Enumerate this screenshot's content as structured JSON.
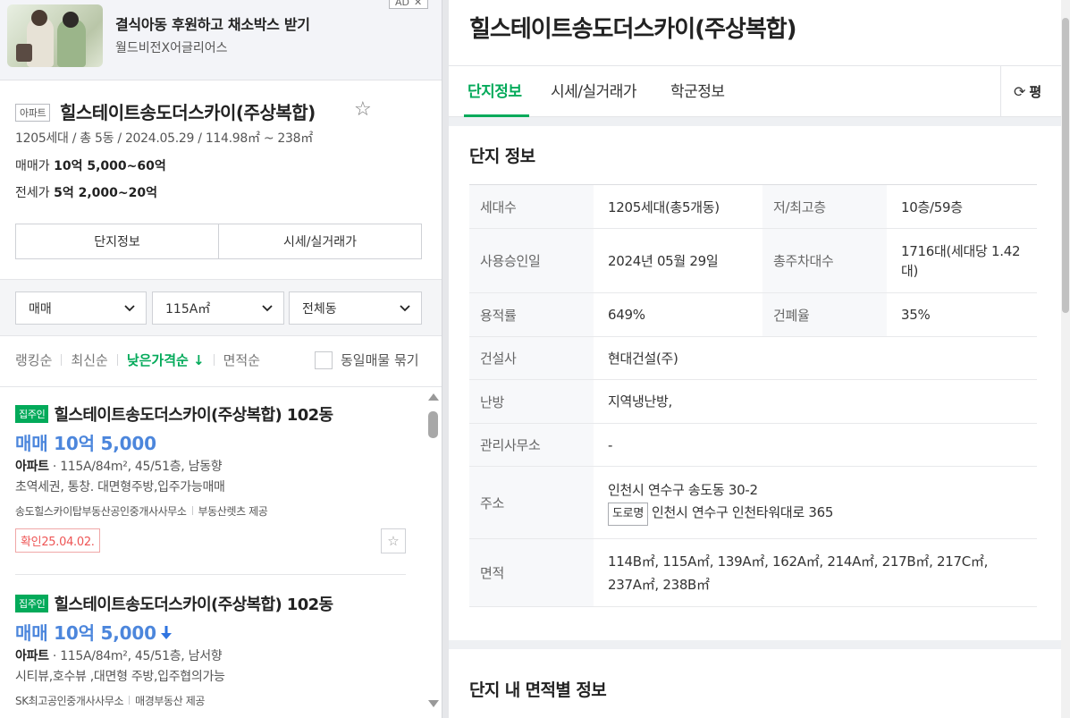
{
  "ad": {
    "title": "결식아동 후원하고 채소박스 받기",
    "subtitle": "월드비전X어글리어스",
    "badge": "AD",
    "close": "✕"
  },
  "summary": {
    "type_badge": "아파트",
    "name": "힐스테이트송도더스카이(주상복합)",
    "meta": "1205세대 / 총 5동 / 2024.05.29 / 114.98㎡ ~ 238㎡",
    "sale_label": "매매가",
    "sale_value": "10억 5,000~60억",
    "jeonse_label": "전세가",
    "jeonse_value": "5억 2,000~20억",
    "buttons": [
      "단지정보",
      "시세/실거래가"
    ]
  },
  "filters": {
    "trade": "매매",
    "area": "115A㎡",
    "dong": "전체동"
  },
  "sort": {
    "options": [
      "랭킹순",
      "최신순",
      "낮은가격순 ↓",
      "면적순"
    ],
    "active_index": 2,
    "same_listing_label": "동일매물 묶기"
  },
  "listings": [
    {
      "tag": "집주인",
      "title": "힐스테이트송도더스카이(주상복합) 102동",
      "price": "매매 10억 5,000",
      "price_down": false,
      "type": "아파트",
      "spec": "115A/84m², 45/51층, 남동향",
      "desc": "초역세권, 통창. 대면형주방,입주가능매매",
      "agent": "송도힐스카이탑부동산공인중개사사무소",
      "provider": "부동산렛츠 제공",
      "confirm": "확인25.04.02."
    },
    {
      "tag": "집주인",
      "title": "힐스테이트송도더스카이(주상복합) 102동",
      "price": "매매 10억 5,000",
      "price_down": true,
      "type": "아파트",
      "spec": "115A/84m², 45/51층, 남서향",
      "desc": "시티뷰,호수뷰 ,대면형 주방,입주협의가능",
      "agent": "SK최고공인중개사사무소",
      "provider": "매경부동산 제공"
    }
  ],
  "detail": {
    "title": "힐스테이트송도더스카이(주상복합)",
    "tabs": [
      "단지정보",
      "시세/실거래가",
      "학군정보"
    ],
    "unit_toggle": "평",
    "section_title": "단지 정보",
    "rows": {
      "households_k": "세대수",
      "households_v": "1205세대(총5개동)",
      "floors_k": "저/최고층",
      "floors_v": "10층/59층",
      "approval_k": "사용승인일",
      "approval_v": "2024년 05월 29일",
      "parking_k": "총주차대수",
      "parking_v": "1716대(세대당 1.42대)",
      "far_k": "용적률",
      "far_v": "649%",
      "bcr_k": "건폐율",
      "bcr_v": "35%",
      "builder_k": "건설사",
      "builder_v": "현대건설(주)",
      "heating_k": "난방",
      "heating_v": "지역냉난방,",
      "office_k": "관리사무소",
      "office_v": "-",
      "address_k": "주소",
      "address_v": "인천시 연수구 송도동 30-2",
      "road_badge": "도로명",
      "road_v": "인천시 연수구 인천타워대로 365",
      "area_k": "면적",
      "area_v": "114B㎡, 115A㎡, 139A㎡, 162A㎡, 214A㎡, 217B㎡, 217C㎡, 237A㎡, 238B㎡"
    },
    "section2_title": "단지 내 면적별 정보"
  },
  "colors": {
    "accent": "#03aa5a",
    "price": "#4c86dc",
    "confirm": "#e55555"
  },
  "icons": [
    "star-icon",
    "chevron-down-icon",
    "refresh-icon",
    "arrow-down-icon"
  ]
}
